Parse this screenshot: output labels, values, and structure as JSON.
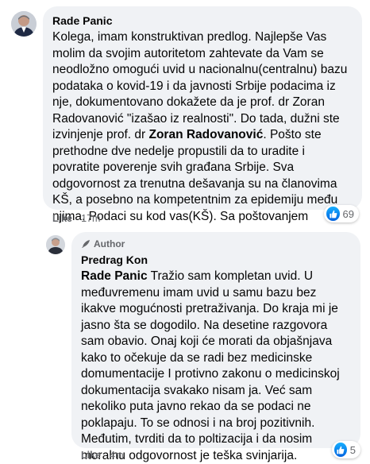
{
  "comment": {
    "author": "Rade Panic",
    "text": "Kolega, imam konstruktivan predlog. Najlepše Vas molim da svojim autoritetom zahtevate da Vam se neodložno omogući uvid u nacionalnu(centralnu) bazu podataka o kovid-19 i da javnosti Srbije podacima iz nje, dokumentovano dokažete da je prof. dr Zoran Radovanović \"izašao iz realnosti\". Do tada, dužni ste izvinjenje prof. dr ",
    "mention": "Zoran Radovanović",
    "text_after": ". Pošto ste prethodne dve nedelje propustili da to uradite i povratite poverenje svih građana Srbije. Sva odgovornost za trenutna dešavanja su na članovima KŠ, a posebno na kompetentnim za epidemiju među njima. Podaci su kod vas(KŠ). Sa poštovanjem",
    "like_label": "Like",
    "time": "17m",
    "reaction_count": "69"
  },
  "reply": {
    "badge": "Author",
    "author": "Predrag Kon",
    "mention": "Rade Panic",
    "text": " Tražio sam kompletan uvid. U međuvremenu imam uvid u samu bazu bez ikakve mogućnosti pretraživanja. Do kraja mi je jasno šta se dogodilo. Na desetine razgovora sam obavio. Onaj koji će morati da objašnjava kako to očekuje da se radi bez medicinske domumentacije I protivno zakonu o medicinskoj dokumentacija svakako nisam ja. Već sam nekoliko puta javno rekao da se podaci ne poklapaju. To se odnosi i na broj pozitivnih. Međutim, tvrditi da to poltizacija i da nosim moralnu odgovornost je teška svinjarija.",
    "like_label": "Like",
    "time": "4m",
    "reaction_count": "5"
  },
  "icons": {
    "like_reaction": "thumbs-up-icon",
    "author_badge": "quill-pen-icon"
  },
  "colors": {
    "bubble": "#f0f2f5",
    "secondary_text": "#65676b",
    "like_blue": "#1877f2"
  }
}
